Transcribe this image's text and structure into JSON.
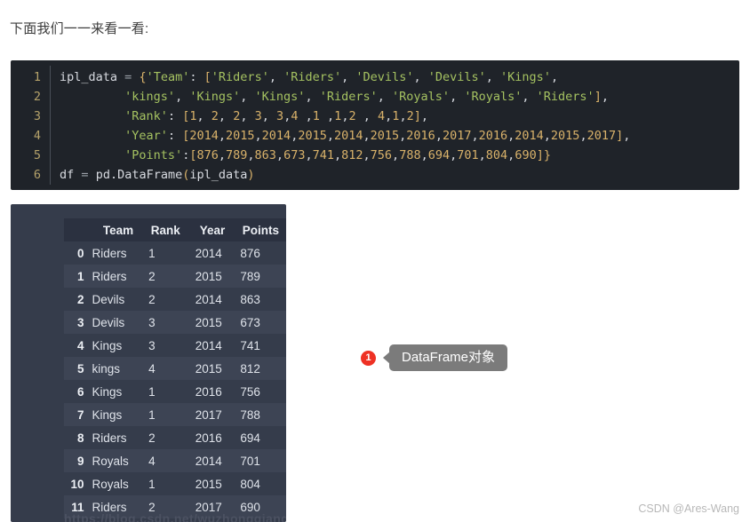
{
  "intro": {
    "text": "下面我们一一来看一看:"
  },
  "code_block": {
    "language": "python",
    "line_numbers": [
      "1",
      "2",
      "3",
      "4",
      "5",
      "6"
    ],
    "lines": [
      "ipl_data = {'Team': ['Riders', 'Riders', 'Devils', 'Devils', 'Kings',",
      "         'kings', 'Kings', 'Kings', 'Riders', 'Royals', 'Royals', 'Riders'],",
      "         'Rank': [1, 2, 2, 3, 3,4 ,1 ,1,2 , 4,1,2],",
      "         'Year': [2014,2015,2014,2015,2014,2015,2016,2017,2016,2014,2015,2017],",
      "         'Points':[876,789,863,673,741,812,756,788,694,701,804,690]}",
      "df = pd.DataFrame(ipl_data)"
    ]
  },
  "dataframe": {
    "columns": [
      "Team",
      "Rank",
      "Year",
      "Points"
    ],
    "index_header": "",
    "rows": [
      {
        "index": "0",
        "Team": "Riders",
        "Rank": "1",
        "Year": "2014",
        "Points": "876"
      },
      {
        "index": "1",
        "Team": "Riders",
        "Rank": "2",
        "Year": "2015",
        "Points": "789"
      },
      {
        "index": "2",
        "Team": "Devils",
        "Rank": "2",
        "Year": "2014",
        "Points": "863"
      },
      {
        "index": "3",
        "Team": "Devils",
        "Rank": "3",
        "Year": "2015",
        "Points": "673"
      },
      {
        "index": "4",
        "Team": "Kings",
        "Rank": "3",
        "Year": "2014",
        "Points": "741"
      },
      {
        "index": "5",
        "Team": "kings",
        "Rank": "4",
        "Year": "2015",
        "Points": "812"
      },
      {
        "index": "6",
        "Team": "Kings",
        "Rank": "1",
        "Year": "2016",
        "Points": "756"
      },
      {
        "index": "7",
        "Team": "Kings",
        "Rank": "1",
        "Year": "2017",
        "Points": "788"
      },
      {
        "index": "8",
        "Team": "Riders",
        "Rank": "2",
        "Year": "2016",
        "Points": "694"
      },
      {
        "index": "9",
        "Team": "Royals",
        "Rank": "4",
        "Year": "2014",
        "Points": "701"
      },
      {
        "index": "10",
        "Team": "Royals",
        "Rank": "1",
        "Year": "2015",
        "Points": "804"
      },
      {
        "index": "11",
        "Team": "Riders",
        "Rank": "2",
        "Year": "2017",
        "Points": "690"
      }
    ]
  },
  "callout": {
    "number": "1",
    "label": "DataFrame对象"
  },
  "watermarks": {
    "csdn": "CSDN @Ares-Wang",
    "url": "https://blog.csdn.net/wuzhongqiang"
  },
  "colors": {
    "page_background": "#ffffff",
    "code_background": "#1f2329",
    "code_gutter_text": "#b5a26a",
    "code_string": "#a5c261",
    "code_number": "#d9b26a",
    "code_punctuation": "#d9b26a",
    "code_text": "#d7dae0",
    "panel_background": "#353c4b",
    "table_header_background": "#2b3140",
    "table_row_alt_background": "#3d4454",
    "table_text": "#e6e9ef",
    "callout_badge": "#ee3124",
    "callout_bubble": "#7b7b7b",
    "watermark_text": "#b8b8b8"
  }
}
